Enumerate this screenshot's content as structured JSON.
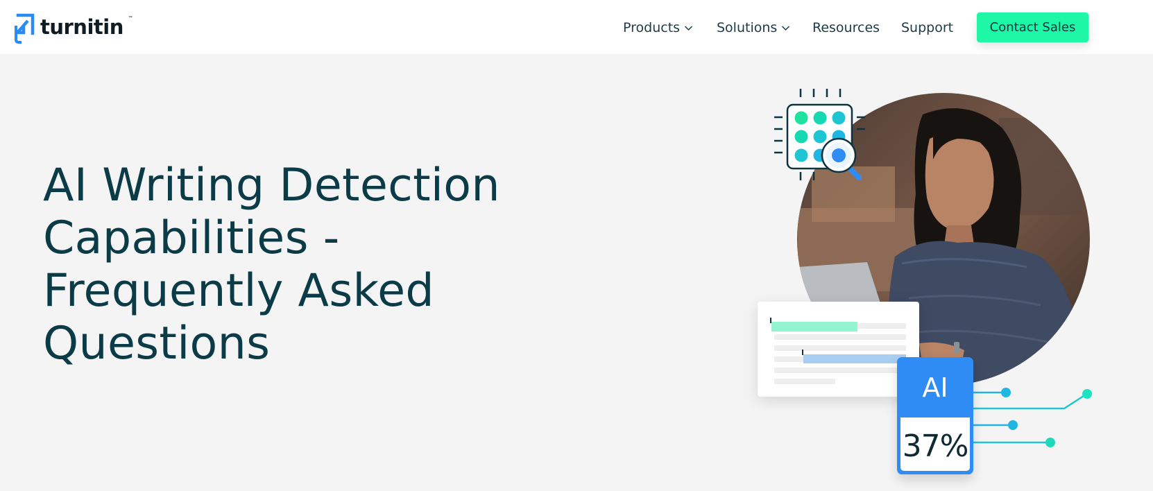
{
  "header": {
    "logo_text": "turnitin",
    "logo_tm": "™",
    "nav": {
      "products": "Products",
      "solutions": "Solutions",
      "resources": "Resources",
      "support": "Support"
    },
    "cta_label": "Contact Sales"
  },
  "hero": {
    "title": "AI Writing Detection Capabilities - Frequently Asked Questions",
    "ai_badge": {
      "label": "AI",
      "value": "37%"
    }
  },
  "colors": {
    "accent_green": "#1ef8a6",
    "brand_blue": "#2f8cf4",
    "text_dark": "#0a3b47",
    "page_bg": "#f4f4f4"
  },
  "icons": [
    "turnitin-logo-icon",
    "chevron-down-icon",
    "chip-search-icon",
    "photo-person"
  ]
}
